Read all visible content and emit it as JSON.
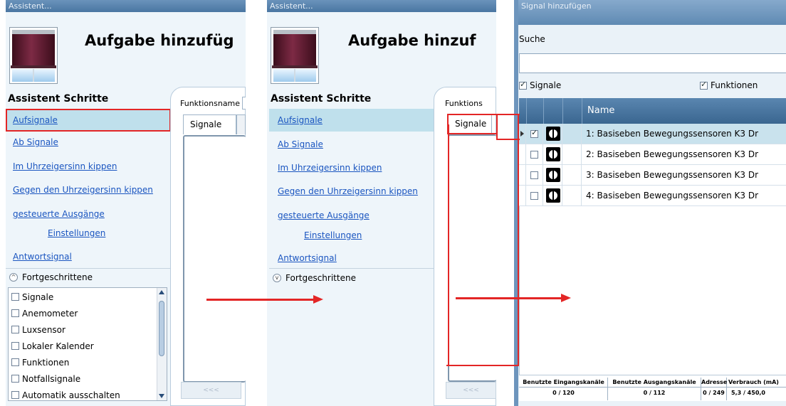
{
  "panel1": {
    "title": "Assistent...",
    "heading": "Aufgabe hinzufüg",
    "steps_title": "Assistent Schritte",
    "steps": [
      "Aufsignale",
      "Ab Signale",
      "Im Uhrzeigersinn kippen",
      "Gegen den Uhrzeigersinn kippen",
      "gesteuerte Ausgänge",
      "Einstellungen",
      "Antwortsignal"
    ],
    "advanced_label": "Fortgeschrittene",
    "advanced_items": [
      "Signale",
      "Anemometer",
      "Luxsensor",
      "Lokaler Kalender",
      "Funktionen",
      "Notfallsignale",
      "Automatik ausschalten"
    ],
    "function_name_label": "Funktionsname",
    "tab_label": "Signale",
    "nav_button": "<<<"
  },
  "panel2": {
    "title": "Assistent...",
    "heading": "Aufgabe hinzuf",
    "steps_title": "Assistent Schritte",
    "steps": [
      "Aufsignale",
      "Ab Signale",
      "Im Uhrzeigersinn kippen",
      "Gegen den Uhrzeigersinn kippen",
      "gesteuerte Ausgänge",
      "Einstellungen",
      "Antwortsignal"
    ],
    "advanced_label": "Fortgeschrittene",
    "function_name_label": "Funktions",
    "tab_label": "Signale",
    "nav_button": "<<<"
  },
  "panel3": {
    "title": "Signal hinzufügen",
    "search_label": "Suche",
    "search_value": "",
    "filter_signals": "Signale",
    "filter_functions": "Funktionen",
    "column_name": "Name",
    "rows": [
      {
        "name": "1: Basiseben Bewegungssensoren K3 Dr",
        "checked": true
      },
      {
        "name": "2: Basiseben Bewegungssensoren K3 Dr",
        "checked": false
      },
      {
        "name": "3: Basiseben Bewegungssensoren K3 Dr",
        "checked": false
      },
      {
        "name": "4: Basiseben Bewegungssensoren K3 Dr",
        "checked": false
      }
    ],
    "status": {
      "headers": [
        "Benutzte Eingangskanäle",
        "Benutzte Ausgangskanäle",
        "Adresse",
        "Verbrauch (mA)"
      ],
      "values": [
        "0 / 120",
        "0 / 112",
        "0 / 249",
        "5,3 / 450,0"
      ]
    }
  },
  "colors": {
    "highlight": "#e32626",
    "link": "#1a55c0",
    "titlebar": "#5a86b1",
    "selected_row": "#c9e2ed",
    "grid_header": "#3f6a93"
  }
}
